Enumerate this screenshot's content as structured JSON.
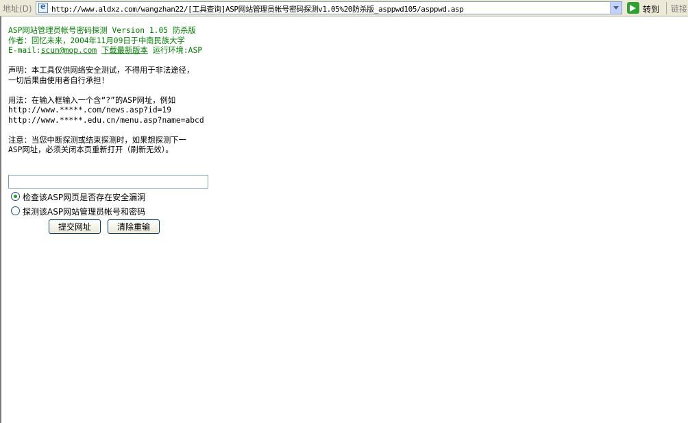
{
  "address_bar": {
    "label": "地址(D)",
    "url": "http://www.aldxz.com/wangzhan22/[工具查询]ASP网站管理员帐号密码探测v1.05%20防杀版_asppwd105/asppwd.asp",
    "go_label": "转到",
    "links_label": "链接"
  },
  "page": {
    "header": {
      "title_line": "ASP网站管理员帐号密码探测 Version 1.05 防杀版",
      "author_line": "作者：回忆未来，2004年11月09日于中南民族大学",
      "email_prefix": "E-mail:",
      "email": "scun@mop.com",
      "download_link": "下载最新版本",
      "env": "运行环境:ASP"
    },
    "disclaimer": [
      "声明：本工具仅供网络安全测试，不得用于非法途径，",
      "一切后果由使用者自行承担！"
    ],
    "usage": [
      "用法：在输入框输入一个含“?”的ASP网址，例如",
      "http://www.*****.com/news.asp?id=19",
      "http://www.*****.edu.cn/menu.asp?name=abcd"
    ],
    "note": [
      "注意：当您中断探测或结束探测时，如果想探测下一",
      "ASP网址，必须关闭本页重新打开（刷新无效）。"
    ],
    "form": {
      "url_value": "",
      "options": [
        {
          "label": "检查该ASP网页是否存在安全漏洞",
          "selected": true
        },
        {
          "label": "探测该ASP网站管理员帐号和密码",
          "selected": false
        }
      ],
      "submit_label": "提交网址",
      "reset_label": "清除重输"
    }
  }
}
